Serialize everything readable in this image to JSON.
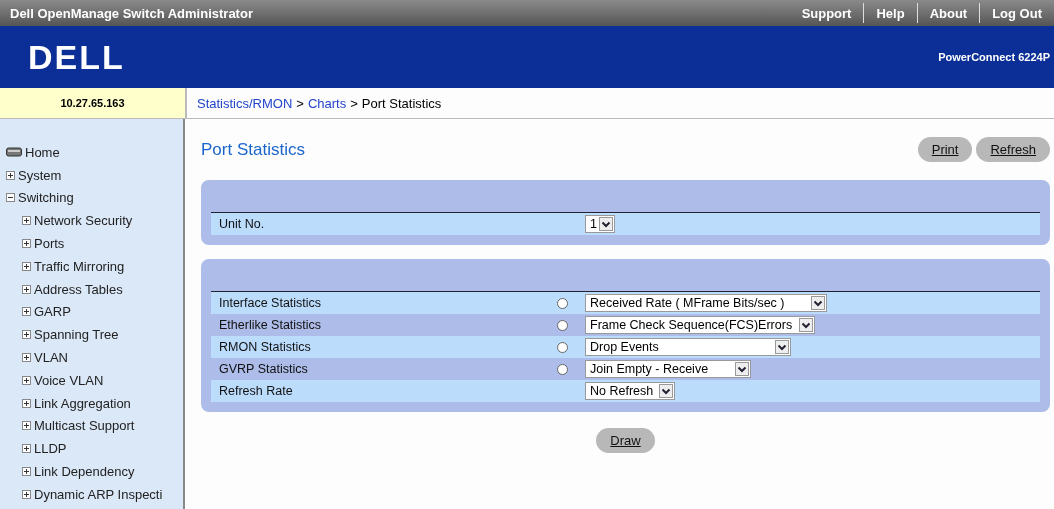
{
  "app_title": "Dell OpenManage Switch Administrator",
  "top_links": [
    "Support",
    "Help",
    "About",
    "Log Out"
  ],
  "logo": "DELL",
  "model": "PowerConnect 6224P",
  "ip_address": "10.27.65.163",
  "breadcrumb": [
    {
      "label": "Statistics/RMON",
      "link": true
    },
    {
      "label": "Charts",
      "link": true
    },
    {
      "label": "Port Statistics",
      "link": false
    }
  ],
  "breadcrumb_separator": ">",
  "sidebar": {
    "items": [
      {
        "label": "Home",
        "kind": "home"
      },
      {
        "label": "System",
        "expanded": false
      },
      {
        "label": "Switching",
        "expanded": true,
        "children": [
          {
            "label": "Network Security",
            "expanded": false
          },
          {
            "label": "Ports",
            "expanded": false
          },
          {
            "label": "Traffic Mirroring",
            "expanded": false
          },
          {
            "label": "Address Tables",
            "expanded": false
          },
          {
            "label": "GARP",
            "expanded": false
          },
          {
            "label": "Spanning Tree",
            "expanded": false
          },
          {
            "label": "VLAN",
            "expanded": false
          },
          {
            "label": "Voice VLAN",
            "expanded": false
          },
          {
            "label": "Link Aggregation",
            "expanded": false
          },
          {
            "label": "Multicast Support",
            "expanded": false
          },
          {
            "label": "LLDP",
            "expanded": false
          },
          {
            "label": "Link Dependency",
            "expanded": false
          },
          {
            "label": "Dynamic ARP Inspecti",
            "expanded": false
          }
        ]
      }
    ]
  },
  "page_title": "Port Statistics",
  "header_buttons": [
    "Print",
    "Refresh"
  ],
  "unit_panel": {
    "label": "Unit No.",
    "value": "1"
  },
  "stats_panel": {
    "rows": [
      {
        "kind": "radio",
        "label": "Interface Statistics",
        "selected": false,
        "value": "Received Rate ( MFrame Bits/sec )"
      },
      {
        "kind": "radio",
        "label": "Etherlike Statistics",
        "selected": false,
        "value": "Frame Check Sequence(FCS)Errors"
      },
      {
        "kind": "radio",
        "label": "RMON Statistics",
        "selected": false,
        "value": "Drop Events"
      },
      {
        "kind": "radio",
        "label": "GVRP Statistics",
        "selected": false,
        "value": "Join Empty - Receive"
      },
      {
        "kind": "plain",
        "label": "Refresh Rate",
        "value": "No Refresh"
      }
    ]
  },
  "draw_button": "Draw"
}
